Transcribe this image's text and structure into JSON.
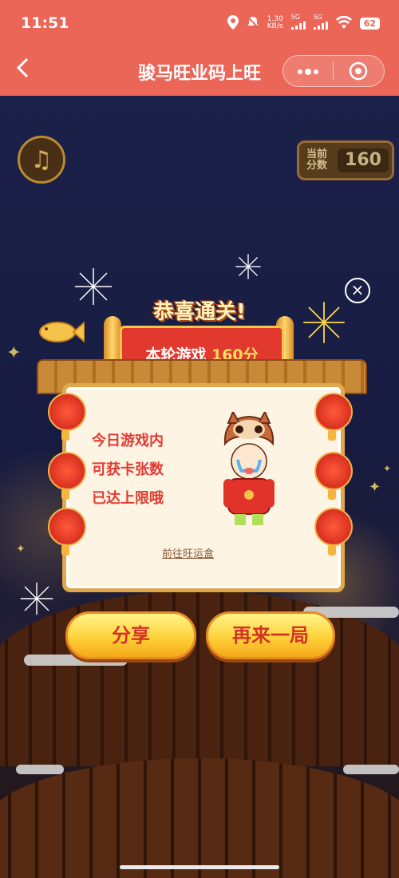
{
  "status_bar": {
    "time": "11:51",
    "net_speed_value": "1.30",
    "net_speed_unit": "KB/s",
    "signal_1": "5G",
    "signal_2": "5G",
    "battery": "62"
  },
  "nav": {
    "title": "骏马旺业码上旺",
    "back_icon": "chevron-left-icon",
    "more_icon": "more-dots-icon",
    "close_icon": "target-circle-icon"
  },
  "game": {
    "music_icon": "music-note-icon",
    "score_label_line1": "当前",
    "score_label_line2": "分数",
    "score_value": "160"
  },
  "modal": {
    "congrats": "恭喜通关!",
    "round_prefix": "本轮游戏",
    "round_score": "160分",
    "message_lines": [
      "今日游戏内",
      "可获卡张数",
      "已达上限哦"
    ],
    "link_text": "前往旺运盒",
    "close_icon": "close-circle-icon",
    "share_button": "分享",
    "replay_button": "再来一局"
  },
  "colors": {
    "header": "#ec6658",
    "button_text": "#d33326",
    "message_text": "#e23a32"
  }
}
